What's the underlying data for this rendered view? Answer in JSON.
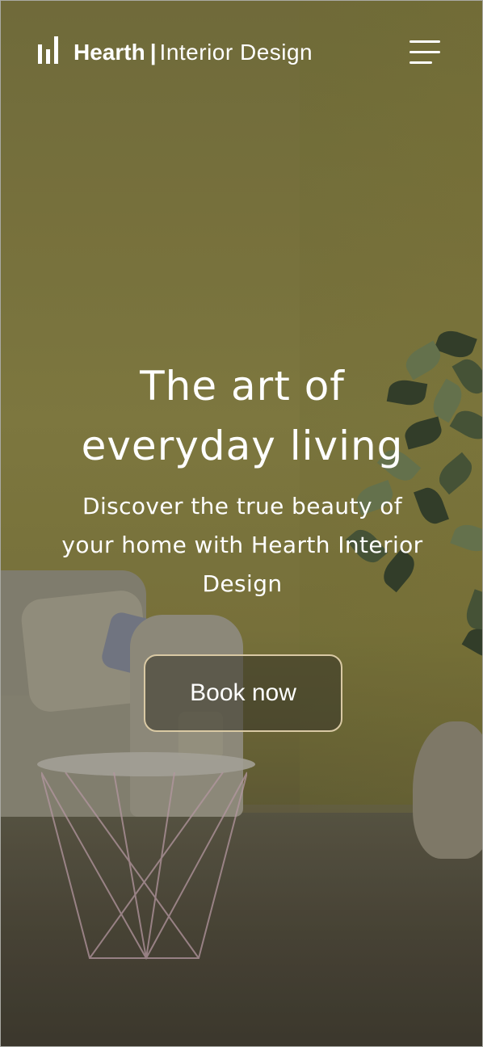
{
  "header": {
    "brand_name": "Hearth",
    "brand_separator": "|",
    "brand_tagline": "Interior Design",
    "logo_icon": "bar-logo-icon",
    "menu_icon": "hamburger-menu-icon"
  },
  "hero": {
    "title_line1": "The art of",
    "title_line2": "everyday living",
    "subtitle": "Discover the true beauty of your home with Hearth Interior Design",
    "cta_label": "Book now"
  },
  "colors": {
    "text": "#ffffff",
    "cta_border": "#d9c9a4",
    "wall": "#8a8446"
  }
}
